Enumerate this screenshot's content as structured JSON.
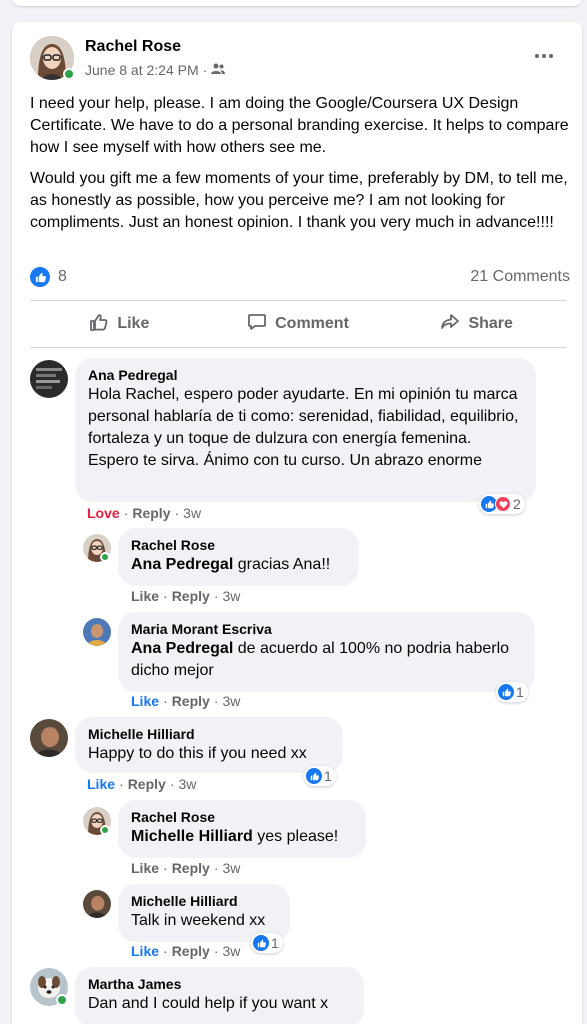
{
  "post": {
    "author": "Rachel Rose",
    "date": "June 8 at 2:24 PM",
    "separator": "·",
    "paragraph1": "I need your help, please. I am doing the Google/Coursera UX Design Certificate. We have to do a personal branding exercise. It helps to compare how I see myself with how others see me.",
    "paragraph2": "Would you gift me a few moments of your time, preferably by DM, to tell me, as honestly as possible, how you perceive me? I am not looking for compliments. Just an honest opinion. I thank you very much in advance!!!!",
    "reaction_count": "8",
    "comments_count": "21 Comments"
  },
  "actions": {
    "like": "Like",
    "comment": "Comment",
    "share": "Share"
  },
  "comment_labels": {
    "love": "Love",
    "like": "Like",
    "reply": "Reply",
    "dot": "·"
  },
  "comments": [
    {
      "name": "Ana Pedregal",
      "text": "Hola Rachel, espero poder ayudarte. En mi opinión tu marca personal hablaría de ti como: serenidad, fiabilidad, equilibrio, fortaleza y un toque de dulzura con energía femenina. Espero te sirva. Ánimo con tu curso. Un abrazo enorme",
      "time": "3w",
      "reactions": "2"
    },
    {
      "name": "Rachel Rose",
      "tag": "Ana Pedregal",
      "text": "gracias Ana!!",
      "time": "3w"
    },
    {
      "name": "Maria Morant Escriva",
      "tag": "Ana Pedregal",
      "text": "de acuerdo al 100% no podria haberlo dicho mejor",
      "time": "3w",
      "reactions": "1"
    },
    {
      "name": "Michelle Hilliard",
      "text": "Happy to do this if you need xx",
      "time": "3w",
      "reactions": "1"
    },
    {
      "name": "Rachel Rose",
      "tag": "Michelle Hilliard",
      "text": "yes please!",
      "time": "3w"
    },
    {
      "name": "Michelle Hilliard",
      "text": "Talk in weekend xx",
      "time": "3w",
      "reactions": "1"
    },
    {
      "name": "Martha James",
      "text": "Dan and I could help if you want x"
    }
  ],
  "colors": {
    "accent": "#1877f2",
    "love": "#e41e3f",
    "online": "#31a24c",
    "muted": "#65676b"
  },
  "icons": {
    "audience": "friends-icon",
    "like": "thumbs-up-icon",
    "comment": "speech-bubble-icon",
    "share": "share-arrow-icon",
    "more": "more-dots-icon"
  }
}
